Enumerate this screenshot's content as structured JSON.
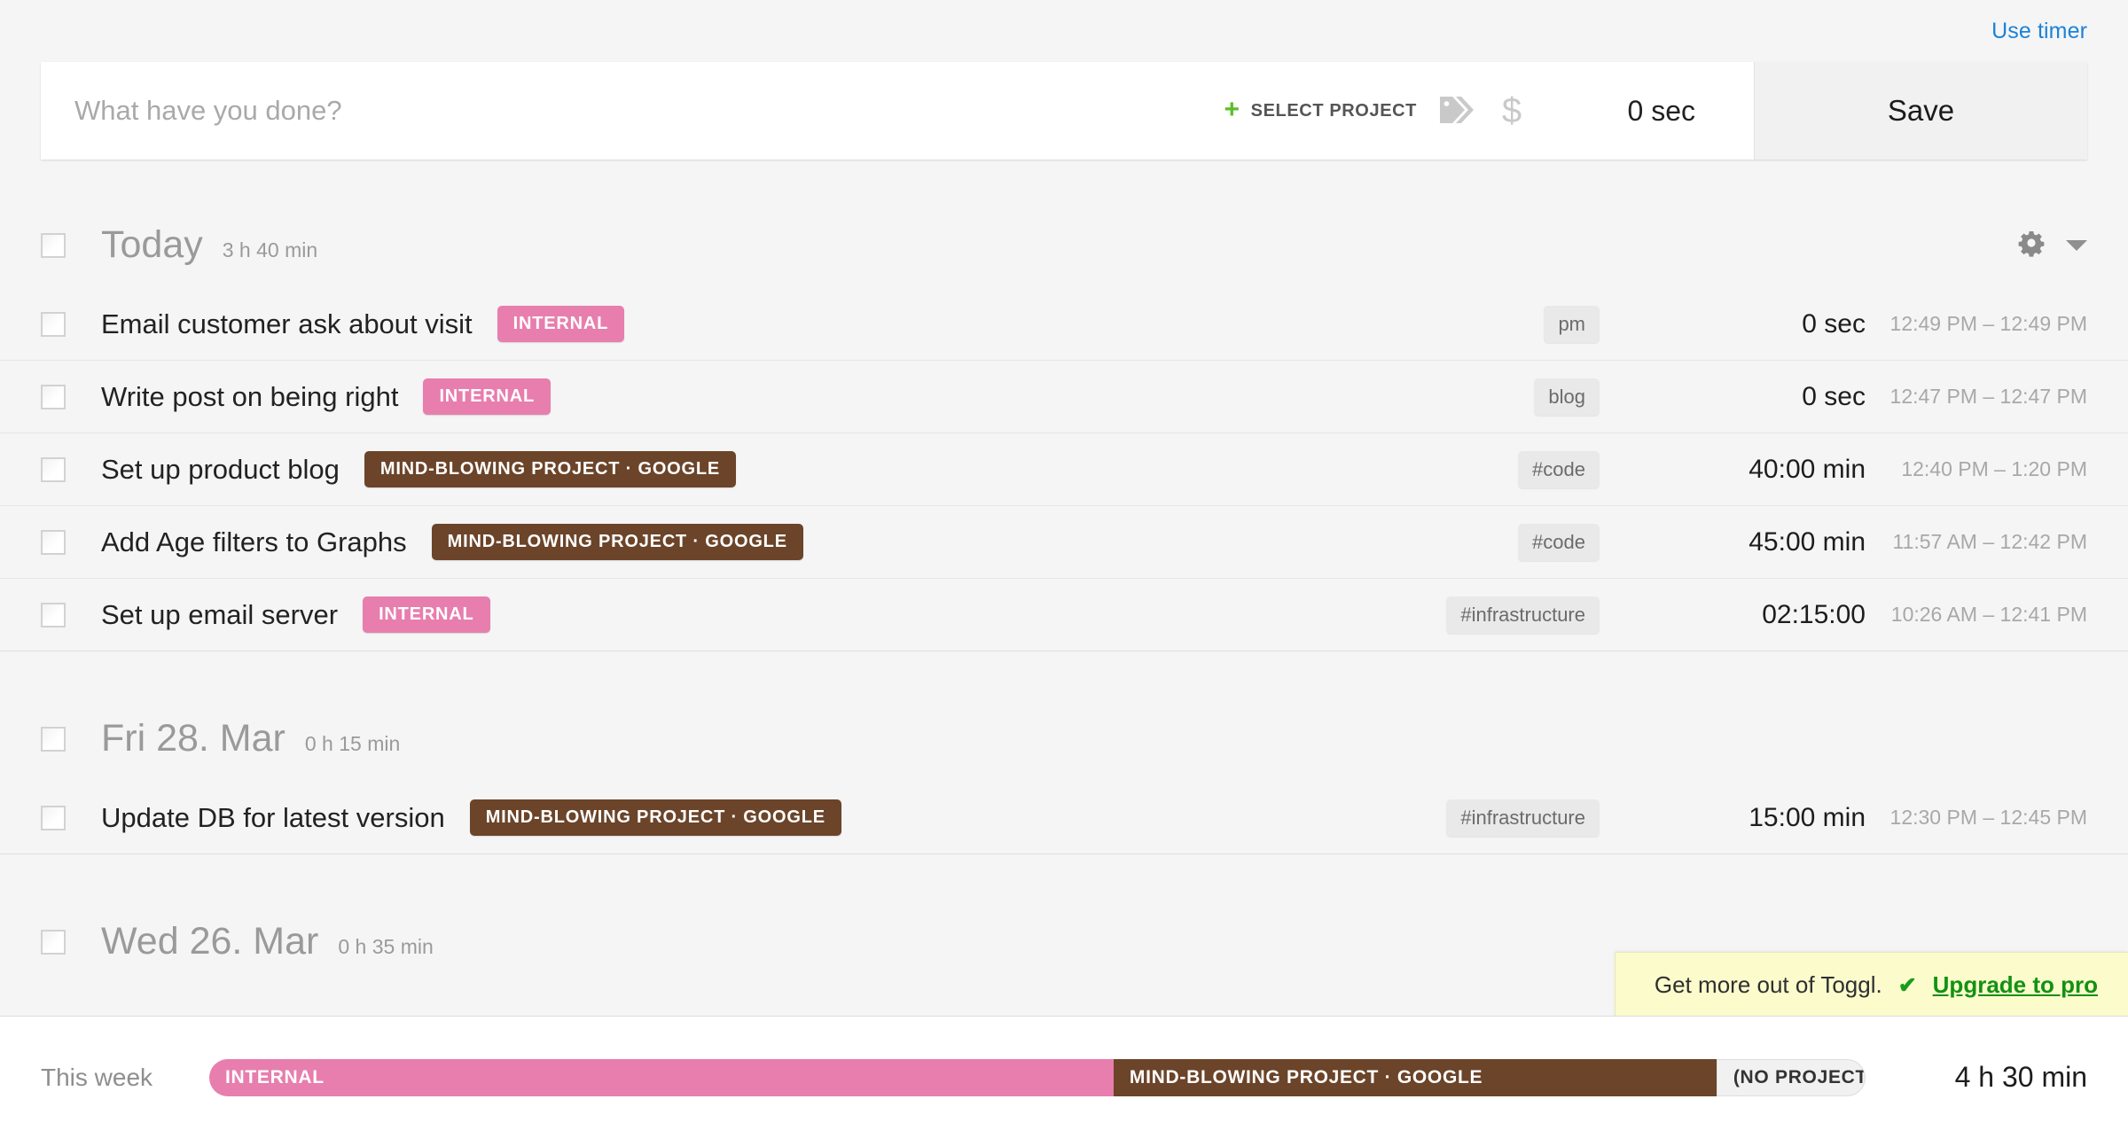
{
  "header": {
    "use_timer_label": "Use timer"
  },
  "entry_form": {
    "description_value": "",
    "description_placeholder": "What have you done?",
    "select_project_label": "SELECT PROJECT",
    "tag_icon": "tag-icon",
    "billable_icon": "dollar-icon",
    "duration": "0 sec",
    "save_label": "Save"
  },
  "days": [
    {
      "title": "Today",
      "total": "3 h 40 min",
      "has_actions": true,
      "entries": [
        {
          "title": "Email customer ask about visit",
          "project": "INTERNAL",
          "project_color": "#e77eae",
          "tag": "pm",
          "duration": "0 sec",
          "time_range": "12:49 PM – 12:49 PM"
        },
        {
          "title": "Write post on being right",
          "project": "INTERNAL",
          "project_color": "#e77eae",
          "tag": "blog",
          "duration": "0 sec",
          "time_range": "12:47 PM – 12:47 PM"
        },
        {
          "title": "Set up product blog",
          "project": "MIND-BLOWING PROJECT · GOOGLE",
          "project_color": "#6b4429",
          "tag": "#code",
          "duration": "40:00 min",
          "time_range": "12:40 PM – 1:20 PM"
        },
        {
          "title": "Add Age filters to Graphs",
          "project": "MIND-BLOWING PROJECT · GOOGLE",
          "project_color": "#6b4429",
          "tag": "#code",
          "duration": "45:00 min",
          "time_range": "11:57 AM – 12:42 PM"
        },
        {
          "title": "Set up email server",
          "project": "INTERNAL",
          "project_color": "#e77eae",
          "tag": "#infrastructure",
          "duration": "02:15:00",
          "time_range": "10:26 AM – 12:41 PM"
        }
      ]
    },
    {
      "title": "Fri 28. Mar",
      "total": "0 h 15 min",
      "has_actions": false,
      "entries": [
        {
          "title": "Update DB for latest version",
          "project": "MIND-BLOWING PROJECT · GOOGLE",
          "project_color": "#6b4429",
          "tag": "#infrastructure",
          "duration": "15:00 min",
          "time_range": "12:30 PM – 12:45 PM"
        }
      ]
    },
    {
      "title": "Wed 26. Mar",
      "total": "0 h 35 min",
      "has_actions": false,
      "entries": []
    }
  ],
  "upgrade_banner": {
    "text": "Get more out of Toggl.",
    "check_icon": "check-icon",
    "link_label": "Upgrade to pro"
  },
  "footer": {
    "label": "This week",
    "total": "4 h 30 min",
    "segments": [
      {
        "label": "INTERNAL",
        "color": "#e77eae",
        "text_color": "#ffffff",
        "width_pct": 54.6
      },
      {
        "label": "MIND-BLOWING PROJECT · GOOGLE",
        "color": "#6b4429",
        "text_color": "#ffffff",
        "width_pct": 36.4
      },
      {
        "label": "(NO PROJECT)",
        "color": "#f1f1f1",
        "text_color": "#333333",
        "width_pct": 9.0
      }
    ]
  },
  "colors": {
    "accent_link": "#1b82d9",
    "green": "#5bbd2a",
    "internal": "#e77eae",
    "project_brown": "#6b4429",
    "banner_bg": "#fbfbcc"
  }
}
